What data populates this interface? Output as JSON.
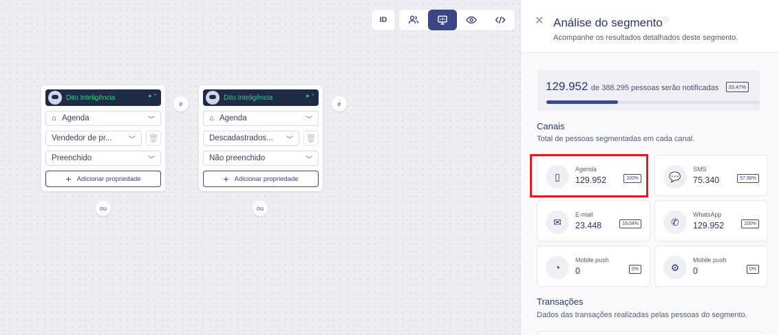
{
  "toolbar": {
    "id_label": "ID",
    "buttons": [
      "people-icon",
      "presentation-icon",
      "eye-icon",
      "code-icon"
    ],
    "active": "presentation-icon"
  },
  "canvas": {
    "cards": [
      {
        "brand": "Dito Inteligência",
        "select1": "Agenda",
        "select2": "Vendedor de pr...",
        "select3": "Preenchido",
        "add_label": "Adicionar propriedade"
      },
      {
        "brand": "Dito Inteligência",
        "select1": "Agenda",
        "select2": "Descadastrados...",
        "select3": "Não preenchido",
        "add_label": "Adicionar propriedade"
      }
    ],
    "and_label": "e",
    "or_label": "ou"
  },
  "panel": {
    "title": "Análise do segmento",
    "subtitle": "Acompanhe os resultados detalhados deste segmento.",
    "summary": {
      "count": "129.952",
      "text": "de 388.295 pessoas serão notificadas",
      "percent": "33,47%",
      "progress": 0.3347
    },
    "channels": {
      "title": "Canais",
      "subtitle": "Total de pessoas segmentadas em cada canal.",
      "items": [
        {
          "name": "Agenda",
          "value": "129.952",
          "percent": "100%",
          "icon": "agenda-icon"
        },
        {
          "name": "SMS",
          "value": "75.340",
          "percent": "57,98%",
          "icon": "chat-icon"
        },
        {
          "name": "E-mail",
          "value": "23.448",
          "percent": "18,04%",
          "icon": "mail-icon"
        },
        {
          "name": "WhatsApp",
          "value": "129.952",
          "percent": "100%",
          "icon": "whatsapp-icon"
        },
        {
          "name": "Mobile push",
          "value": "0",
          "percent": "0%",
          "icon": "apple-icon"
        },
        {
          "name": "Mobile push",
          "value": "0",
          "percent": "0%",
          "icon": "android-icon"
        }
      ]
    },
    "transactions": {
      "title": "Transações",
      "subtitle": "Dados das transações realizadas pelas pessoas do segmento."
    }
  },
  "colors": {
    "accent": "#3b4685",
    "highlight": "#e01b24",
    "brand_green": "#2ed48a"
  }
}
